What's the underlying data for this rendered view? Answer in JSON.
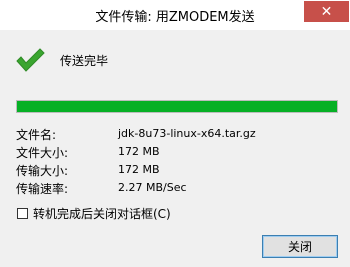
{
  "window": {
    "title": "文件传输: 用ZMODEM发送",
    "close_glyph": "✕"
  },
  "status": {
    "text": "传送完毕",
    "icon": "check-icon",
    "icon_color": "#3aa52f"
  },
  "progress": {
    "fraction": 1.0,
    "fill_color": "#06b025"
  },
  "info": [
    {
      "label": "文件名:",
      "value": "jdk-8u73-linux-x64.tar.gz"
    },
    {
      "label": "文件大小:",
      "value": "172 MB"
    },
    {
      "label": "传输大小:",
      "value": "172 MB"
    },
    {
      "label": "传输速率:",
      "value": "2.27 MB/Sec"
    }
  ],
  "option": {
    "label": "转机完成后关闭对话框(C)",
    "checked": false
  },
  "buttons": {
    "close_label": "关闭"
  },
  "colors": {
    "titlebar_close": "#c7504a"
  }
}
